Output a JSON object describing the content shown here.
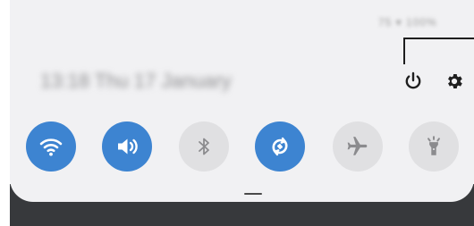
{
  "status_bar": {
    "text": "75 ▾ 100%"
  },
  "header": {
    "datetime": "13:18 Thu 17 January"
  },
  "header_icons": [
    {
      "name": "power-icon"
    },
    {
      "name": "gear-icon"
    }
  ],
  "quick_tiles": [
    {
      "name": "wifi-icon",
      "state": "on"
    },
    {
      "name": "sound-icon",
      "state": "on"
    },
    {
      "name": "bluetooth-icon",
      "state": "off"
    },
    {
      "name": "auto-rotate-icon",
      "state": "on"
    },
    {
      "name": "airplane-mode-icon",
      "state": "off"
    },
    {
      "name": "flashlight-icon",
      "state": "off"
    }
  ],
  "colors": {
    "active_tile": "#3d84d1",
    "inactive_tile": "#e0e0e2",
    "panel_background": "#f1f1f3",
    "inactive_icon": "#8b8b8e"
  }
}
